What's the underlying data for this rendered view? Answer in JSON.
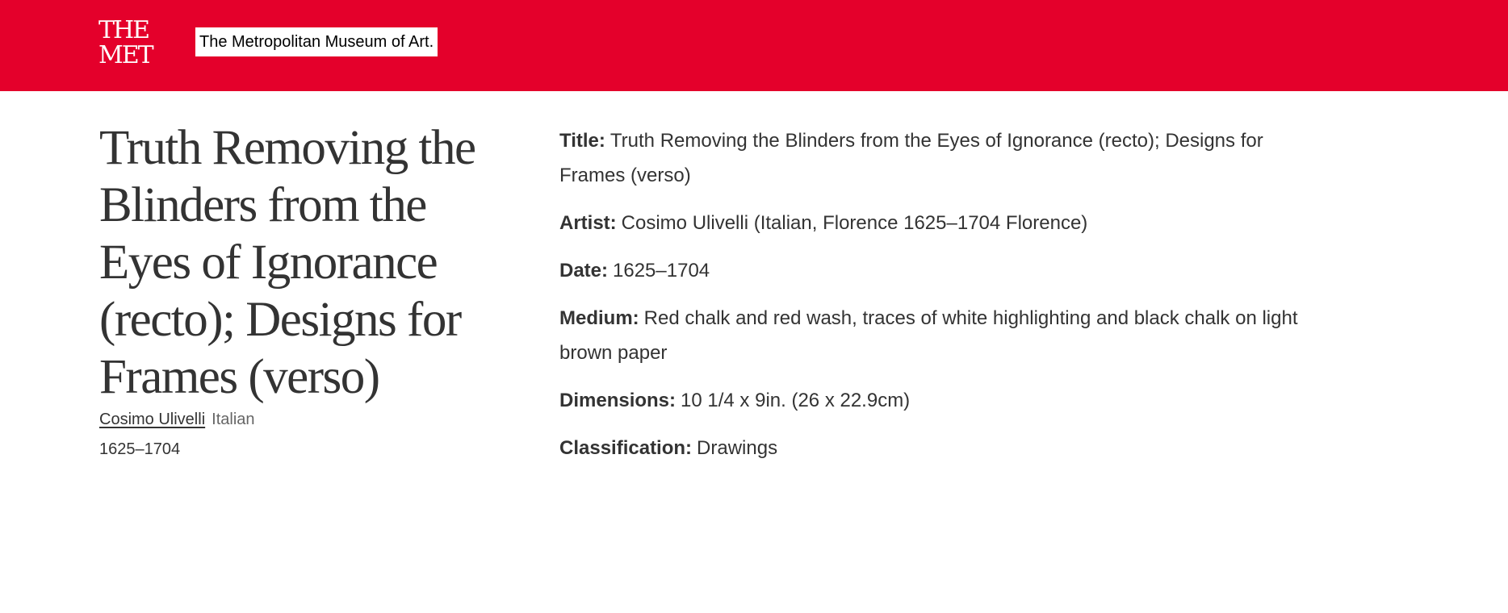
{
  "header": {
    "logo_line1": "THE",
    "logo_line2": "MET",
    "site_name": "The Metropolitan Museum of Art.",
    "background_color": "#e4002b"
  },
  "artwork": {
    "title": "Truth Removing the Blinders from the Eyes of Ignorance (recto); Designs for Frames (verso)",
    "artist_name": "Cosimo Ulivelli",
    "nationality": "Italian",
    "date": "1625–1704"
  },
  "details": [
    {
      "label": "Title:",
      "value": "Truth Removing the Blinders from the Eyes of Ignorance (recto); Designs for Frames (verso)"
    },
    {
      "label": "Artist:",
      "value": "Cosimo Ulivelli (Italian, Florence 1625–1704 Florence)"
    },
    {
      "label": "Date:",
      "value": "1625–1704"
    },
    {
      "label": "Medium:",
      "value": "Red chalk and red wash, traces of white highlighting and black chalk on light brown paper"
    },
    {
      "label": "Dimensions:",
      "value": "10 1/4 x 9in. (26 x 22.9cm)"
    },
    {
      "label": "Classification:",
      "value": "Drawings"
    }
  ]
}
